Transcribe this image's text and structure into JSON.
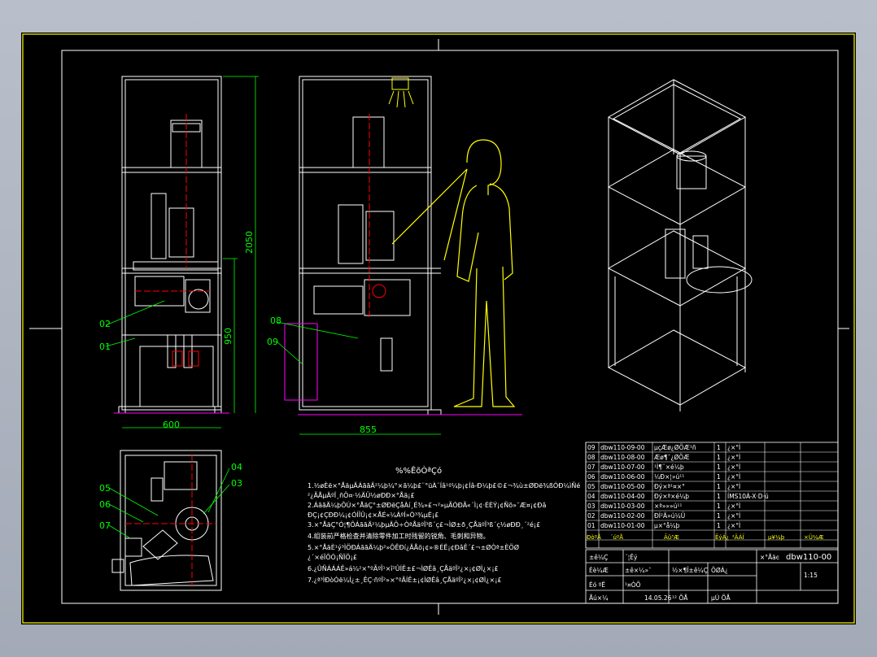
{
  "drawing": {
    "dims": {
      "height_total": "2050",
      "height_table": "950",
      "width_front": "600",
      "width_side": "855"
    },
    "callouts": [
      "01",
      "02",
      "03",
      "04",
      "05",
      "06",
      "07",
      "08",
      "09"
    ],
    "notes_title": "%%ÊõÒªÇó",
    "notes": [
      "1.½øÈë×°ÅäµÄÁããÄ²¼þ¼°×ã¼þ£¨°üÀ¨Íâ¹º¼þ¡¢Íâ-Ð¼þ£©£¬¾ù±ØÐë¾ßÓÐ¼ìÑé",
      "  ²¿ÃÅµÄºÏ¸ñÖ¤·½ÄÜ½øÐÐ×°Åä¡£",
      "2.ÁããÄ¼þÔÚ×°ÅäÇ°±ØÐëÇåÀí¸É¾»£¬²»µÃÓÐÃ«´Ì¡¢·ÉÈÝ¡¢Ñõ»¯Æ¤¡¢Ðâ",
      "  ÐÇ¡¢ÇÐÐ¼¡¢ÓÍÎÛ¡¢×ÅÉ«¼ÁºÍ»Ò³¾µÈ¡£",
      "3.×°ÅäÇ°Ó¦¶ÔÁããÄ²¼þµÄÖ÷ÒªÅäºÏ³ß´ç£¬ÌØ±ð¸ÇÅäºÏ³ß´ç½øÐÐ¸´²é¡£",
      "4.组装前严格检查并清除零件加工时残留的锐角、毛刺和异物。",
      "5.×°ÅäÈ¹ý³ÌÖÐÁããÄ¼þ²»ÔÊÐí¿ÄÅö¡¢»®ÉË¡¢ÐâÊ´£¬±ØÒª±ÈÖØ",
      "  ¿´×éÏÔÓ¡ÑÏÖ¡£",
      "6.¿ÛÑÁÁÁÊ»á¼²×°ºÃºÎ¹×î²ÛÍÊ±£¬ÌØÊâ¸ÇÅäºÏ²¿×¡¢ØÌ¿×¡£",
      "7.¿ª³ÌÐòÓë¼Í¿±¸ÊÇ·ñºÏ²»×°ºÃÍÊ±¡¢ÌØÊâ¸ÇÅäºÏ²¿×¡¢ØÌ¿×¡£"
    ]
  },
  "bom": {
    "rows": [
      {
        "no": "09",
        "code": "dbw110-09-00",
        "name": "µçÆø¿ØÖÆ¹ñ",
        "qty": "1",
        "mat": "¿×°Ì"
      },
      {
        "no": "08",
        "code": "dbw110-08-00",
        "name": "Æø¶¯¿ØÖÆ",
        "qty": "1",
        "mat": "¿×°Ì"
      },
      {
        "no": "07",
        "code": "dbw110-07-00",
        "name": "¹Ì¶¨×é¼þ",
        "qty": "1",
        "mat": "¿×°Ì"
      },
      {
        "no": "06",
        "code": "dbw110-06-00",
        "name": "¼Ð×¦»ú¹¹",
        "qty": "1",
        "mat": "¿×°Ì"
      },
      {
        "no": "05",
        "code": "dbw110-05-00",
        "name": "Ðý×ª¹¤×°",
        "qty": "1",
        "mat": "¿×°Ì"
      },
      {
        "no": "04",
        "code": "dbw110-04-00",
        "name": "Ðý×ª×é¼þ",
        "qty": "1",
        "mat": "ÍMS10Á-X·D·ú"
      },
      {
        "no": "03",
        "code": "dbw110-03-00",
        "name": "×ª»»»ú¹¹",
        "qty": "1",
        "mat": "¿×°Ì"
      },
      {
        "no": "02",
        "code": "dbw110-02-00",
        "name": "ÐÍ²Ä»ú¼Ü",
        "qty": "1",
        "mat": "¿×°Ì"
      },
      {
        "no": "01",
        "code": "dbw110-01-00",
        "name": "µ×°å¼þ",
        "qty": "1",
        "mat": "¿×°Ì"
      }
    ],
    "header": {
      "no": "ÐòºÅ",
      "code": "´úºÅ",
      "name": "Ãû³Æ",
      "qty": "ÊýÁ¿",
      "mat": "²ÄÁÏ",
      "single": "µ¥¼þ",
      "total": "×Ü¼Æ",
      "weight": "ÖØÁ¿",
      "remark": "±¸×¢"
    }
  },
  "titleblock": {
    "drawing_no": "dbw110-00",
    "scale": "1:15",
    "date": "14.05.26",
    "cells": [
      "±ê¼Ç",
      "´¦Êý",
      "·ÖÇø",
      "¸ü¸ÄÎÄ¼þºÅ",
      "Ç©Ãû",
      "Éè¼Æ",
      "±ê×¼»¯",
      "Éó ºË",
      "¹¤ÒÕ",
      "Åú×¼",
      "½×¶Î±ê¼Ç",
      "ÖØÁ¿",
      "±ÈÀý",
      "¹²  ÕÅ",
      "µÚ  ÕÅ",
      "×°Åäͼ"
    ]
  }
}
